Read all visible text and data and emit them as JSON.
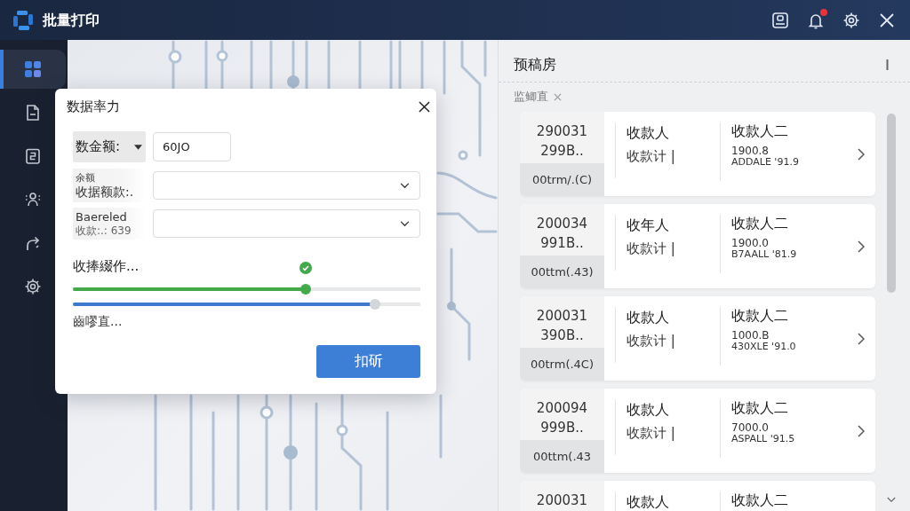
{
  "title_bar": {
    "title": "批量打印",
    "icons": [
      {
        "kind": "portrait"
      },
      {
        "kind": "bell",
        "dot": true
      },
      {
        "kind": "settings"
      },
      {
        "kind": "close"
      }
    ]
  },
  "sidebar": {
    "items": [
      {
        "kind": "grid",
        "selected": true
      },
      {
        "kind": "document",
        "selected": false
      },
      {
        "kind": "clipboard",
        "selected": false
      },
      {
        "kind": "person",
        "selected": false
      },
      {
        "kind": "share",
        "selected": false
      },
      {
        "kind": "settings",
        "selected": false
      }
    ]
  },
  "dialog": {
    "title": "数据率力",
    "fields": [
      {
        "kind": "text",
        "label": [
          "数金额:"
        ],
        "label_dropdown": true,
        "value": "60JO"
      },
      {
        "kind": "select",
        "label": [
          "余额",
          "收据额款:."
        ],
        "label_dropdown": false
      },
      {
        "kind": "select",
        "label": [
          "Baereled",
          "收款:.: 639"
        ],
        "label_dropdown": false
      }
    ],
    "progress_label": "收捧綴作...",
    "sliders": [
      {
        "level": 0.67,
        "color": "#43a94b",
        "checked": true
      },
      {
        "level": 0.87,
        "color": "#3f78cf",
        "checked": false
      }
    ],
    "status": "齒嘐直...",
    "button": "扣斫"
  },
  "panel": {
    "title": "预稿房",
    "filter_tag": {
      "label": "监鲫直"
    },
    "cards": [
      {
        "id": [
          "290031",
          "299B.."
        ],
        "code": "00trm/.(C)",
        "payee": "收款人",
        "payee_note": "收款计 |",
        "name": "收款人二",
        "amount": "1900.8",
        "ref": "ADDALE '91.9",
        "chevron": true
      },
      {
        "id": [
          "200034",
          "991B.."
        ],
        "code": "00ttm(.43)",
        "payee": "收年人",
        "payee_note": "收款计 |",
        "name": "收款人二",
        "amount": "1900.0",
        "ref": "B7AALL '81.9",
        "chevron": true
      },
      {
        "id": [
          "200031",
          "390B.."
        ],
        "code": "00trm(.4C)",
        "payee": "收款人",
        "payee_note": "收款计 |",
        "name": "收款人二",
        "amount": "1000.B",
        "ref": "430XLE '91.0",
        "chevron": true
      },
      {
        "id": [
          "200094",
          "999B.."
        ],
        "code": "00ttm(.43",
        "payee": "收款人",
        "payee_note": "收款计 |",
        "name": "收款人二",
        "amount": "7000.0",
        "ref": "ASPALL '91.5",
        "chevron": true
      },
      {
        "id": [
          "200031"
        ],
        "payee": "收款人",
        "name": "收款人二"
      }
    ]
  }
}
